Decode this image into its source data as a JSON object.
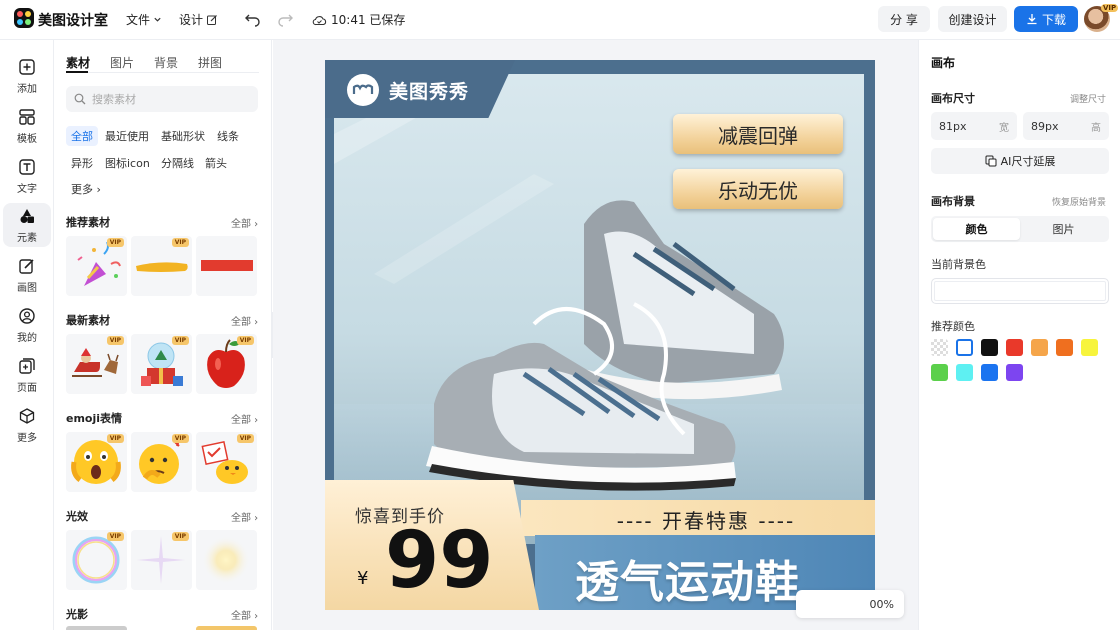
{
  "app": {
    "title": "美图设计室"
  },
  "topbar": {
    "file_menu": "文件",
    "design_menu": "设计",
    "save_status": "10:41 已保存",
    "share_label": "分 享",
    "create_label": "创建设计",
    "download_label": "下载",
    "avatar_badge": "VIP"
  },
  "leftnav": [
    {
      "label": "添加",
      "icon": "plus-square-icon"
    },
    {
      "label": "模板",
      "icon": "template-icon"
    },
    {
      "label": "文字",
      "icon": "text-icon"
    },
    {
      "label": "元素",
      "icon": "shapes-icon"
    },
    {
      "label": "画图",
      "icon": "draw-icon"
    },
    {
      "label": "我的",
      "icon": "user-icon"
    },
    {
      "label": "页面",
      "icon": "page-add-icon"
    },
    {
      "label": "更多",
      "icon": "cube-icon"
    }
  ],
  "active_nav": "元素",
  "panel": {
    "tabs": [
      "素材",
      "图片",
      "背景",
      "拼图"
    ],
    "search_placeholder": "搜索素材",
    "chips": [
      "全部",
      "最近使用",
      "基础形状",
      "线条",
      "异形",
      "图标icon",
      "分隔线",
      "箭头",
      "更多"
    ],
    "sections": [
      {
        "title": "推荐素材",
        "all": "全部"
      },
      {
        "title": "最新素材",
        "all": "全部"
      },
      {
        "title": "emoji表情",
        "all": "全部"
      },
      {
        "title": "光效",
        "all": "全部"
      },
      {
        "title": "光影",
        "all": "全部"
      }
    ],
    "vip_label": "VIP"
  },
  "canvas": {
    "brand_name": "美图秀秀",
    "pill_1": "减震回弹",
    "pill_2": "乐动无优",
    "price_label": "惊喜到手价",
    "currency": "¥",
    "price": "99",
    "promo": "---- 开春特惠 ----",
    "headline": "透气运动鞋",
    "zoom": "00%"
  },
  "right_panel": {
    "title": "画布",
    "size_label": "画布尺寸",
    "adjust_size": "调整尺寸",
    "width_value": "81px",
    "width_unit": "宽",
    "height_value": "89px",
    "height_unit": "高",
    "ai_extend": "AI尺寸延展",
    "bg_label": "画布背景",
    "restore_bg": "恢复原始背景",
    "bg_tabs": [
      "颜色",
      "图片"
    ],
    "current_bg": "当前背景色",
    "recommended": "推荐颜色",
    "swatches": [
      "transparent",
      "#ffffff",
      "#111111",
      "#e9392a",
      "#f5a54a",
      "#ef6f1f",
      "#f7f43c",
      "#5bd04b",
      "#5ef0f2",
      "#1b74f0",
      "#7d45f0"
    ]
  },
  "colors": {
    "accent": "#1a73e8",
    "canvas_frame": "#4c6f8e"
  }
}
